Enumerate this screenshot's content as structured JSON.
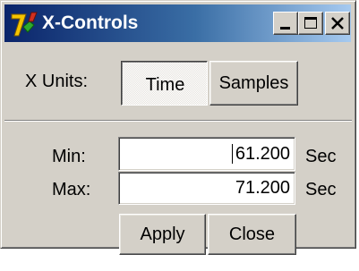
{
  "window": {
    "title": "X-Controls",
    "icon": "app-logo-icon",
    "caption_buttons": [
      "minimize-icon",
      "maximize-icon",
      "close-icon"
    ]
  },
  "units": {
    "label": "X Units:",
    "options": [
      "Time",
      "Samples"
    ],
    "selected": "Time"
  },
  "range": {
    "min": {
      "label": "Min:",
      "value": "61.200",
      "unit": "Sec"
    },
    "max": {
      "label": "Max:",
      "value": "71.200",
      "unit": "Sec"
    }
  },
  "actions": {
    "apply_label": "Apply",
    "close_label": "Close"
  },
  "colors": {
    "title_gradient_start": "#0a246a",
    "title_gradient_end": "#a6caf0",
    "face": "#d4d0c8",
    "field_background": "#ffffff"
  }
}
